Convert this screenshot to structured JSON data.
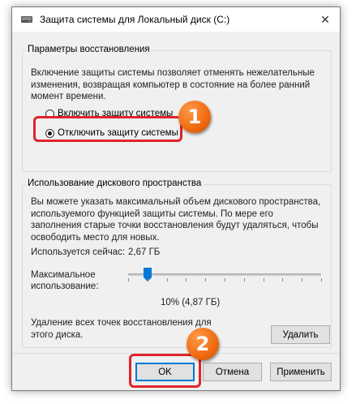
{
  "window": {
    "title": "Защита системы для Локальный диск (C:)",
    "close_glyph": "✕"
  },
  "restore": {
    "group_title": "Параметры восстановления",
    "description": "Включение защиты системы позволяет отменять нежелательные изменения, возвращая компьютер в состояние на более ранний момент времени.",
    "options": [
      {
        "label": "Включить защиту системы",
        "selected": false
      },
      {
        "label": "Отключить защиту системы",
        "selected": true
      }
    ],
    "badge": "1"
  },
  "disk": {
    "group_title": "Использование дискового пространства",
    "description": "Вы можете указать максимальный объем дискового пространства, используемого функцией защиты системы. По мере его заполнения старые точки восстановления будут удаляться, чтобы освободить место для новых.",
    "current_label": "Используется сейчас:",
    "current_value": "2,67 ГБ",
    "max_label_line1": "Максимальное",
    "max_label_line2": "использование:",
    "slider_value_fraction": 0.1,
    "slider_text": "10% (4,87 ГБ)",
    "delete_text": "Удаление всех точек восстановления для этого диска.",
    "delete_button": "Удалить"
  },
  "footer": {
    "ok": "OK",
    "cancel": "Отмена",
    "apply": "Применить",
    "badge": "2"
  },
  "colors": {
    "highlight": "#e0242a",
    "badge": "#f06a10",
    "accent": "#0078d7"
  }
}
